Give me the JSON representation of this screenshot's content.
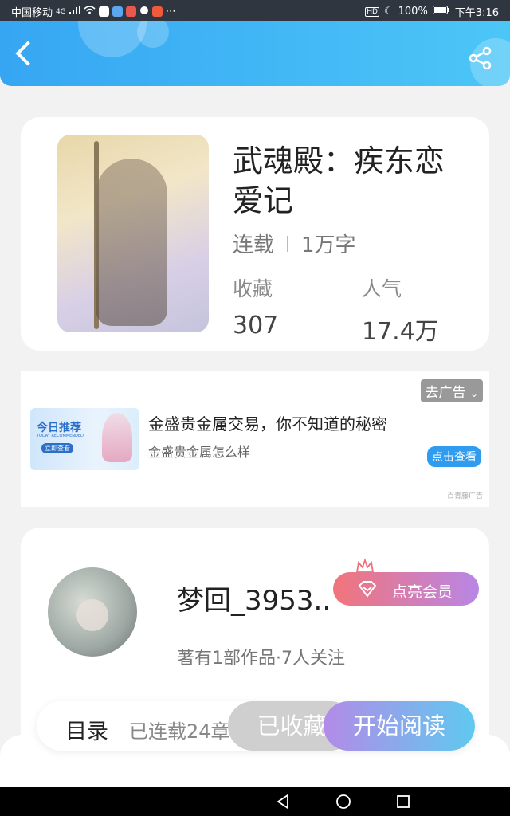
{
  "status_bar": {
    "carrier": "中国移动",
    "network": "4G",
    "battery": "100%",
    "time": "下午3:16"
  },
  "header": {
    "back_icon": "back-icon",
    "share_icon": "share-icon"
  },
  "book": {
    "title": "武魂殿：疾东恋爱记",
    "status": "连载",
    "word_count": "1万字",
    "favorites_label": "收藏",
    "favorites_value": "307",
    "popularity_label": "人气",
    "popularity_value": "17.4万"
  },
  "ad": {
    "tag": "去广告",
    "image_title": "今日推荐",
    "image_subtitle": "TODAY RECOMMENDED",
    "image_button": "立即查看",
    "title": "金盛贵金属交易，你不知道的秘密",
    "subtitle": "金盛贵金属怎么样",
    "button": "点击查看",
    "source": "百青藤广告"
  },
  "author": {
    "name": "梦回_3953..",
    "vip_button": "点亮会员",
    "summary": "著有1部作品·7人关注"
  },
  "action_bar": {
    "toc_label": "目录",
    "toc_sub": "已连载24章",
    "collected": "已收藏",
    "start_reading": "开始阅读"
  },
  "colors": {
    "header_accent": "#36a6f3",
    "read_button_start": "#b38be8",
    "read_button_end": "#5fc9ef",
    "vip_start": "#f2747a",
    "vip_end": "#b886e6"
  }
}
